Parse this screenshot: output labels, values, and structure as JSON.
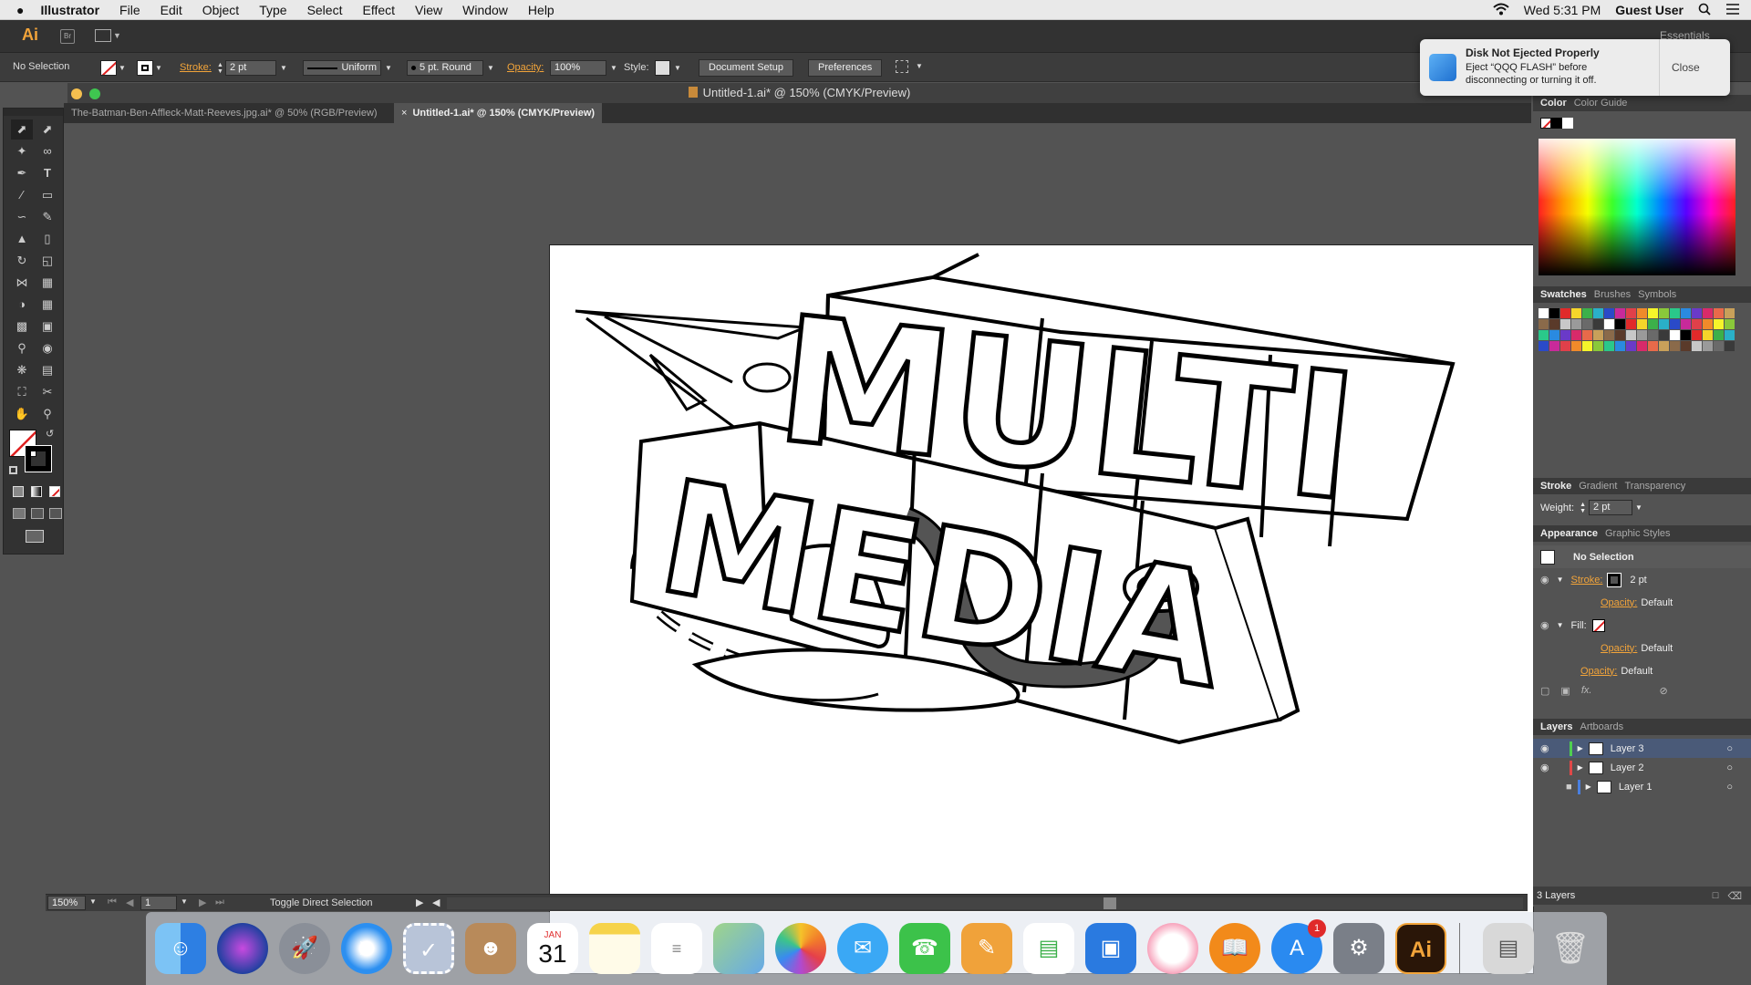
{
  "menubar": {
    "apple": "",
    "app_name": "Illustrator",
    "items": [
      "File",
      "Edit",
      "Object",
      "Type",
      "Select",
      "Effect",
      "View",
      "Window",
      "Help"
    ],
    "clock": "Wed 5:31 PM",
    "user": "Guest User"
  },
  "appbar": {
    "logo": "Ai",
    "bridge": "Br",
    "workspace": "Essentials"
  },
  "control": {
    "selection": "No Selection",
    "stroke_label": "Stroke:",
    "stroke_value": "2 pt",
    "profile": "Uniform",
    "brush": "5 pt. Round",
    "opacity_label": "Opacity:",
    "opacity_value": "100%",
    "style_label": "Style:",
    "document_setup": "Document Setup",
    "preferences": "Preferences"
  },
  "window": {
    "title": "Untitled-1.ai* @ 150% (CMYK/Preview)",
    "tabs": [
      "The-Batman-Ben-Affleck-Matt-Reeves.jpg.ai* @ 50% (RGB/Preview)",
      "Untitled-1.ai* @ 150% (CMYK/Preview)"
    ]
  },
  "artwork": {
    "line1": "MULTI",
    "line2": "MEDIA"
  },
  "status": {
    "zoom": "150%",
    "artboard": "1",
    "tool_text": "Toggle Direct Selection"
  },
  "notification": {
    "title": "Disk Not Ejected Properly",
    "body": "Eject “QQQ FLASH” before disconnecting or turning it off.",
    "close": "Close"
  },
  "panels": {
    "color_tabs": [
      "Color",
      "Color Guide"
    ],
    "swatch_tabs": [
      "Swatches",
      "Brushes",
      "Symbols"
    ],
    "stroke_tabs": [
      "Stroke",
      "Gradient",
      "Transparency"
    ],
    "weight_label": "Weight:",
    "weight_value": "2 pt",
    "appearance_tabs": [
      "Appearance",
      "Graphic Styles"
    ],
    "appearance": {
      "selection": "No Selection",
      "stroke_label": "Stroke:",
      "stroke_value": "2 pt",
      "opacity_label": "Opacity:",
      "opacity_value": "Default",
      "fill_label": "Fill:"
    },
    "layers_tabs": [
      "Layers",
      "Artboards"
    ],
    "layers": [
      {
        "name": "Layer 3",
        "color": "#4fcf4f"
      },
      {
        "name": "Layer 2",
        "color": "#e04848"
      },
      {
        "name": "Layer 1",
        "color": "#4a7fe0"
      }
    ],
    "layer_count": "3 Layers"
  },
  "dock": {
    "calendar_month": "JAN",
    "calendar_day": "31",
    "appstore_badge": "1",
    "illustrator": "Ai"
  }
}
